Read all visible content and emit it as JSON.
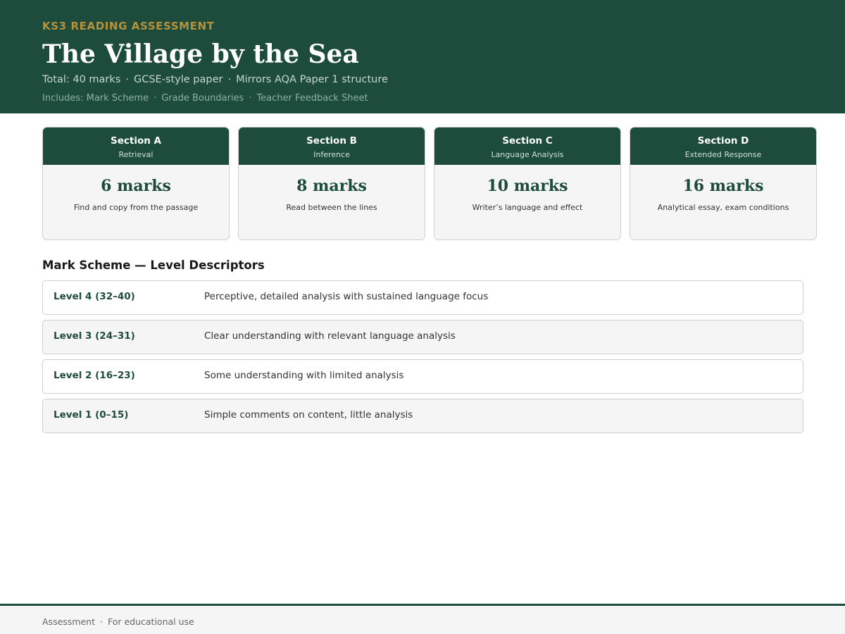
{
  "header": {
    "kicker": "KS3 READING ASSESSMENT",
    "title": "The Village by the Sea",
    "subtitle_parts": [
      "Total: 40 marks",
      "GCSE-style paper",
      "Mirrors AQA Paper 1 structure"
    ],
    "includes_parts": [
      "Includes: Mark Scheme",
      "Grade Boundaries",
      "Teacher Feedback Sheet"
    ],
    "separator": "·"
  },
  "sections": [
    {
      "title": "Section A",
      "subtitle": "Retrieval",
      "marks": "6 marks",
      "description": "Find and copy from the passage"
    },
    {
      "title": "Section B",
      "subtitle": "Inference",
      "marks": "8 marks",
      "description": "Read between the lines"
    },
    {
      "title": "Section C",
      "subtitle": "Language Analysis",
      "marks": "10 marks",
      "description": "Writer’s language and effect"
    },
    {
      "title": "Section D",
      "subtitle": "Extended Response",
      "marks": "16 marks",
      "description": "Analytical essay, exam conditions"
    }
  ],
  "mark_scheme": {
    "heading": "Mark Scheme — Level Descriptors",
    "levels": [
      {
        "name": "Level 4  (32–40)",
        "description": "Perceptive, detailed analysis with sustained language focus"
      },
      {
        "name": "Level 3  (24–31)",
        "description": "Clear understanding with relevant language analysis"
      },
      {
        "name": "Level 2  (16–23)",
        "description": "Some understanding with limited analysis"
      },
      {
        "name": "Level 1  (0–15)",
        "description": "Simple comments on content, little analysis"
      }
    ]
  },
  "footer": {
    "parts": [
      "Assessment",
      "For educational use"
    ],
    "separator": "·"
  },
  "colors": {
    "primary": "#1d4b3c",
    "accent": "#b8923a",
    "panel": "#f5f5f5"
  }
}
